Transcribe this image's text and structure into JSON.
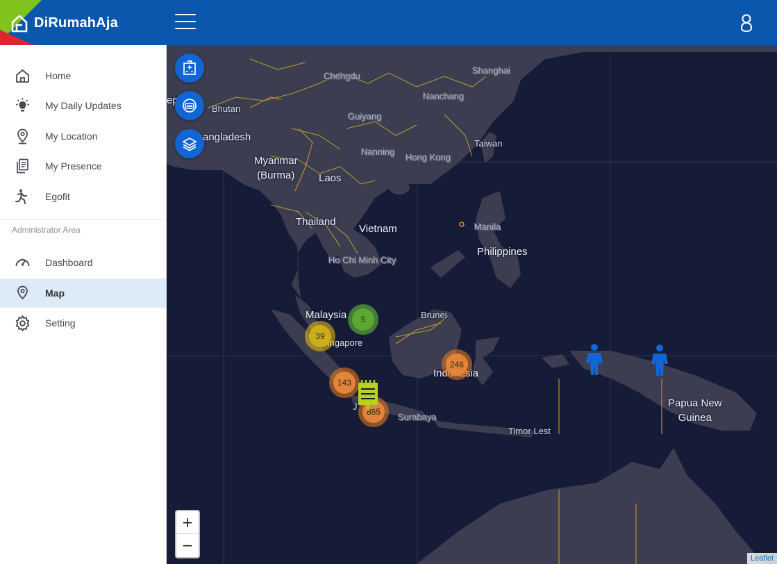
{
  "app": {
    "title": "DiRumahAja"
  },
  "sidebar": {
    "items": [
      {
        "label": "Home",
        "icon": "home-icon"
      },
      {
        "label": "My Daily Updates",
        "icon": "lightbulb-icon"
      },
      {
        "label": "My Location",
        "icon": "location-pin-icon"
      },
      {
        "label": "My Presence",
        "icon": "documents-icon"
      },
      {
        "label": "Egofit",
        "icon": "running-person-icon"
      }
    ],
    "section_label": "Administrator Area",
    "admin_items": [
      {
        "label": "Dashboard",
        "icon": "speedometer-icon"
      },
      {
        "label": "Map",
        "icon": "location-pin-icon",
        "active": true
      },
      {
        "label": "Setting",
        "icon": "gear-icon"
      }
    ]
  },
  "map": {
    "labels": {
      "chengdu": "Chengdu",
      "shanghai": "Shanghai",
      "nanchang": "Nanchang",
      "guiyang": "Guiyang",
      "nanning": "Nanning",
      "hongkong": "Hong Kong",
      "taiwan": "Taiwan",
      "bhutan": "Bhutan",
      "ep": "ep",
      "bangladesh": "angladesh",
      "myanmar": "Myanmar\n(Burma)",
      "laos": "Laos",
      "thailand": "Thailand",
      "vietnam": "Vietnam",
      "manila": "Manila",
      "philippines": "Philippines",
      "hochiminh": "Ho Chi Minh City",
      "malaysia": "Malaysia",
      "brunei": "Brunei",
      "singapore": "Singapore",
      "indonesia": "Indonesia",
      "surabaya": "Surabaya",
      "timor": "Timor Lest",
      "papua": "Papua New\nGuinea",
      "java_j": "J"
    },
    "clusters": [
      {
        "count": "5",
        "color": "green"
      },
      {
        "count": "39",
        "color": "yellow"
      },
      {
        "count": "143",
        "color": "orange"
      },
      {
        "count": "865",
        "color": "orange"
      },
      {
        "count": "246",
        "color": "orange"
      }
    ],
    "zoom_in": "+",
    "zoom_out": "−",
    "attribution": "Leaflet"
  },
  "colors": {
    "header": "#0a57ad",
    "accent_green": "#7fc31c",
    "accent_red": "#e3232e",
    "map_sea": "#161b38",
    "map_land": "#3c3d50",
    "active_item_bg": "#ddeaf7",
    "fab": "#1166d4"
  }
}
